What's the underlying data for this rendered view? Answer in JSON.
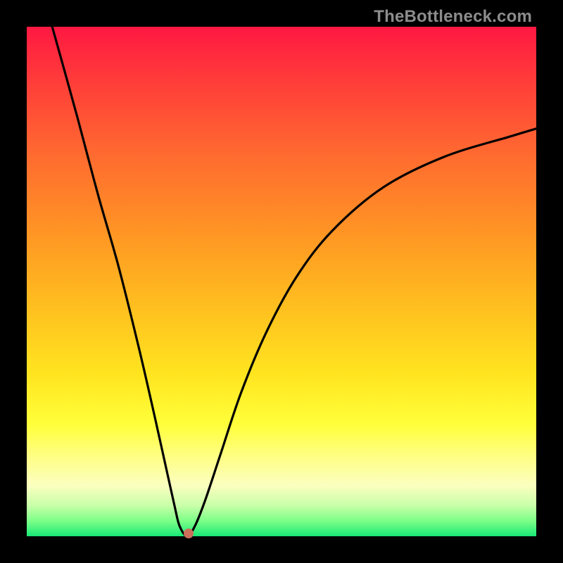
{
  "watermark": "TheBottleneck.com",
  "chart_data": {
    "type": "line",
    "title": "",
    "xlabel": "",
    "ylabel": "",
    "xlim": [
      0,
      100
    ],
    "ylim": [
      0,
      100
    ],
    "grid": false,
    "legend": false,
    "series": [
      {
        "name": "bottleneck-curve",
        "x": [
          5,
          10,
          14,
          18,
          22,
          25,
          27,
          29,
          30,
          31.5,
          33,
          35,
          38,
          42,
          47,
          53,
          60,
          70,
          82,
          95,
          100
        ],
        "y": [
          100,
          82,
          67,
          53,
          37,
          24,
          15,
          6,
          2,
          0,
          2,
          7,
          16,
          28,
          40,
          51,
          60,
          68.5,
          74.5,
          78.5,
          80
        ]
      }
    ],
    "marker": {
      "x": 31.7,
      "y": 0.6
    },
    "background_gradient": {
      "top": "#ff1842",
      "mid": "#ffe41f",
      "bottom": "#18e876"
    }
  }
}
